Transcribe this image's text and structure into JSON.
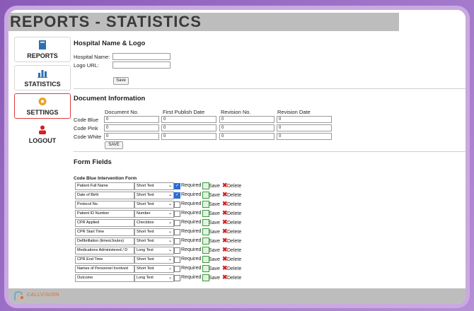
{
  "page_title": "REPORTS - STATISTICS",
  "sidebar": {
    "items": [
      {
        "label": "REPORTS",
        "icon": "book-icon",
        "color": "#2d6fb5"
      },
      {
        "label": "STATISTICS",
        "icon": "bar-chart-icon",
        "color": "#2d6fb5"
      },
      {
        "label": "SETTINGS",
        "icon": "gear-icon",
        "color": "#e8a320",
        "active": true
      },
      {
        "label": "LOGOUT",
        "icon": "user-icon",
        "color": "#d42020"
      }
    ]
  },
  "hospital": {
    "heading": "Hospital Name & Logo",
    "name_label": "Hospital Name:",
    "name_value": "",
    "logo_label": "Logo URL:",
    "logo_value": "",
    "save_label": "Save"
  },
  "document": {
    "heading": "Document Information",
    "columns": [
      "Document No.",
      "First Publish Date",
      "Revision No.",
      "Revision Date"
    ],
    "rows": [
      {
        "label": "Code Blue",
        "values": [
          "0",
          "0",
          "0",
          "0"
        ]
      },
      {
        "label": "Code Pink",
        "values": [
          "0",
          "0",
          "0",
          "0"
        ]
      },
      {
        "label": "Code White",
        "values": [
          "0",
          "0",
          "0",
          "0"
        ]
      }
    ],
    "save_label": "SAVE"
  },
  "form_fields": {
    "heading": "Form Fields",
    "form_title": "Code Blue Intervention Form",
    "required_label": "Required",
    "save_label": "Save",
    "delete_label": "Delete",
    "rows": [
      {
        "name": "Patient Full Name",
        "type": "Short Text",
        "required": true
      },
      {
        "name": "Date of Birth",
        "type": "Short Text",
        "required": true
      },
      {
        "name": "Protocol No.",
        "type": "Short Text",
        "required": false
      },
      {
        "name": "Patient ID Number",
        "type": "Number",
        "required": false
      },
      {
        "name": "CPR Applied",
        "type": "Checkbox",
        "required": false
      },
      {
        "name": "CPR Start Time",
        "type": "Short Text",
        "required": false
      },
      {
        "name": "Defibrillation (times/Joules)",
        "type": "Short Text",
        "required": false
      },
      {
        "name": "Medications Administered / D",
        "type": "Long Text",
        "required": false
      },
      {
        "name": "CPR End Time",
        "type": "Short Text",
        "required": false
      },
      {
        "name": "Names of Personnel Involved",
        "type": "Short Text",
        "required": false
      },
      {
        "name": "Outcome",
        "type": "Long Text",
        "required": false
      }
    ]
  },
  "footer": {
    "brand": "CALLVISION"
  }
}
